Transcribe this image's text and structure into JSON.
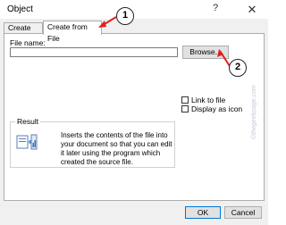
{
  "window": {
    "title": "Object",
    "help_glyph": "?",
    "close_glyph": "✕"
  },
  "tabs": [
    {
      "label": "Create New",
      "active": false
    },
    {
      "label": "Create from File",
      "active": true
    }
  ],
  "form": {
    "file_name_label": "File name:",
    "file_name_value": "",
    "browse_label": "Browse...",
    "link_to_file_label": "Link to file",
    "link_to_file_checked": false,
    "display_as_icon_label": "Display as icon",
    "display_as_icon_checked": false
  },
  "result": {
    "label": "Result",
    "text": "Inserts the contents of the file into your document so that you can edit it later using the program which created the source file."
  },
  "buttons": {
    "ok_label": "OK",
    "cancel_label": "Cancel"
  },
  "annotations": {
    "step1": "1",
    "step2": "2",
    "color": "#e02020"
  },
  "watermark": "©thegeekpage.com"
}
